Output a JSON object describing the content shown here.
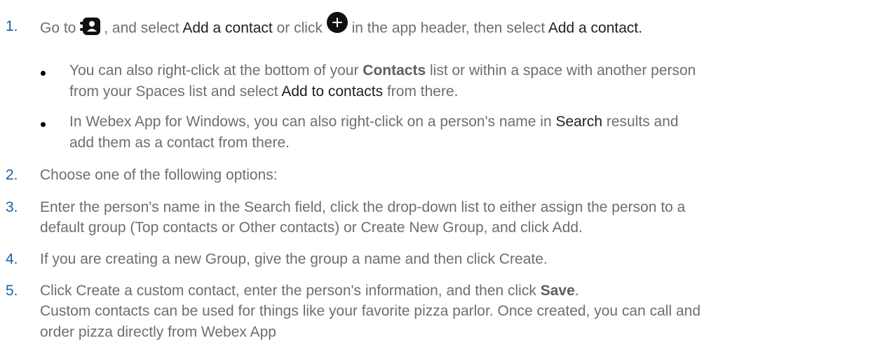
{
  "steps": {
    "s1": {
      "num": "1.",
      "t1": "Go to",
      "t2": ", and select",
      "t3": "Add a contact",
      "t4": "or click",
      "t5": "in the app header, then select",
      "t6": "Add a contact",
      "t7": "."
    },
    "b1": {
      "l1a": "You can also right-click at the bottom of your",
      "l1b": "Contacts",
      "l1c": "list or within a space with another person",
      "l2a": "from your Spaces list and select",
      "l2b": "Add to contacts",
      "l2c": "from there."
    },
    "b2": {
      "l1a": "In Webex App for Windows, you can also right-click on a person's name in",
      "l1b": "Search",
      "l1c": "results and",
      "l2": "add them as a contact from there."
    },
    "s2": {
      "num": "2.",
      "text": "Choose one of the following options:"
    },
    "s3": {
      "num": "3.",
      "l1": "Enter the person's name in the Search field, click the drop-down list to either assign the person to a",
      "l2": "default group (Top contacts or Other contacts) or Create New Group, and click Add."
    },
    "s4": {
      "num": "4.",
      "text": "If you are creating a new Group, give the group a name and then click Create."
    },
    "s5": {
      "num": "5.",
      "l1a": "Click Create a custom contact, enter the person's information, and then click",
      "l1b": "Save",
      "l1c": ".",
      "l2": "Custom contacts can be used for things like your favorite pizza parlor. Once created, you can call and",
      "l3": "order pizza directly from Webex App"
    }
  },
  "icons": {
    "contacts": "contacts-icon",
    "add": "add-circle-icon"
  }
}
